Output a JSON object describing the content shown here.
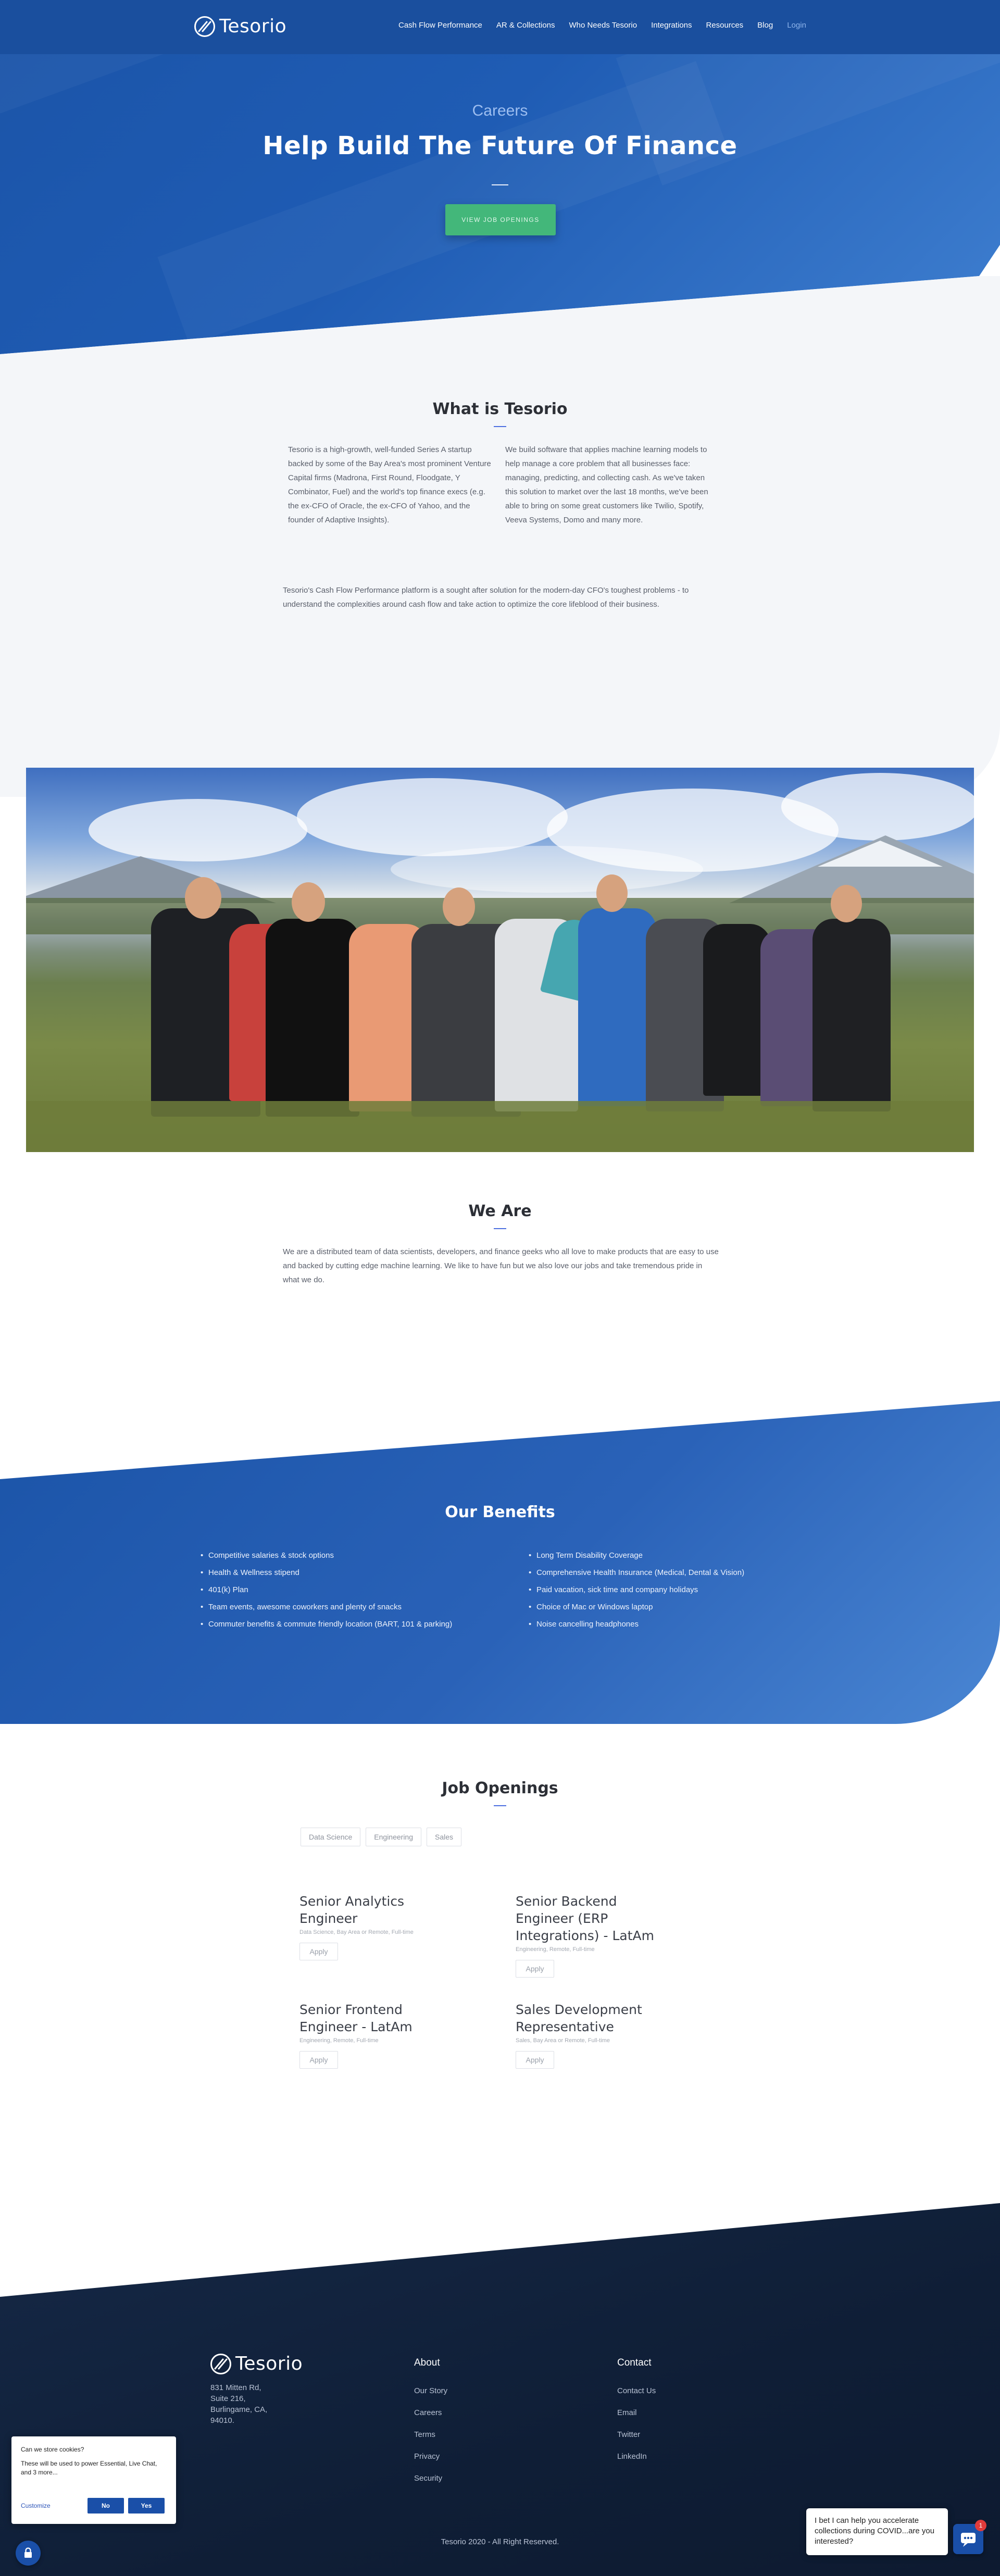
{
  "nav": {
    "brand": "Tesorio",
    "links": [
      "Cash Flow Performance",
      "AR & Collections",
      "Who Needs Tesorio",
      "Integrations",
      "Resources",
      "Blog",
      "Login"
    ]
  },
  "hero": {
    "kicker": "Careers",
    "title": "Help Build The Future Of Finance",
    "cta": "View Job Openings"
  },
  "what": {
    "title": "What is Tesorio",
    "col1": "Tesorio is a high-growth, well-funded Series A startup backed by some of the Bay Area's most prominent Venture Capital firms (Madrona, First Round, Floodgate, Y Combinator, Fuel) and the world's top finance execs (e.g. the ex-CFO of Oracle, the ex-CFO of Yahoo, and the founder of Adaptive Insights).",
    "col2": "We build software that applies machine learning models to help manage a core problem that all businesses face: managing, predicting, and collecting cash. As we've taken this solution to market over the last 18 months, we've been able to bring on some great customers like Twilio, Spotify, Veeva Systems, Domo and many more.",
    "para": "Tesorio's Cash Flow Performance  platform is a sought after solution for the modern-day CFO's toughest problems - to understand the complexities around cash flow and take action to optimize the core lifeblood of their business."
  },
  "we_are": {
    "title": "We Are",
    "text": "We are a distributed team of data scientists, developers, and finance geeks who all love to make products that are easy to use and backed by cutting edge machine learning. We like to have fun but we also love our jobs and take tremendous pride in what we do."
  },
  "benefits": {
    "title": "Our Benefits",
    "left": [
      "Competitive salaries & stock options",
      "Health & Wellness stipend",
      "401(k) Plan",
      "Team events, awesome coworkers and plenty of snacks",
      "Commuter benefits & commute friendly location (BART, 101 & parking)"
    ],
    "right": [
      "Long Term Disability Coverage",
      "Comprehensive Health Insurance (Medical, Dental & Vision)",
      "Paid vacation, sick time and company holidays",
      "Choice of Mac or Windows laptop",
      "Noise cancelling headphones"
    ]
  },
  "jobs": {
    "title": "Job Openings",
    "filters": [
      "Data Science",
      "Engineering",
      "Sales"
    ],
    "apply_label": "Apply",
    "items": [
      {
        "title": "Senior Analytics Engineer",
        "meta": "Data Science, Bay Area or Remote, Full-time"
      },
      {
        "title": "Senior Backend Engineer (ERP Integrations) - LatAm",
        "meta": "Engineering, Remote, Full-time"
      },
      {
        "title": "Senior Frontend Engineer - LatAm",
        "meta": "Engineering, Remote, Full-time"
      },
      {
        "title": "Sales Development Representative",
        "meta": "Sales, Bay Area or Remote, Full-time"
      }
    ]
  },
  "footer": {
    "brand": "Tesorio",
    "address": [
      "831 Mitten Rd,",
      "Suite 216,",
      "Burlingame, CA,",
      "94010."
    ],
    "about_title": "About",
    "about_links": [
      "Our Story",
      "Careers",
      "Terms",
      "Privacy",
      "Security"
    ],
    "contact_title": "Contact",
    "contact_links": [
      "Contact Us",
      "Email",
      "Twitter",
      "LinkedIn"
    ],
    "copyright": "Tesorio 2020 - All Right Reserved."
  },
  "cookie": {
    "title": "Can we store cookies?",
    "text": "These will be used to power Essential, Live Chat, and 3 more...",
    "customize": "Customize",
    "no": "No",
    "yes": "Yes"
  },
  "chat": {
    "message": "I bet I can help you accelerate collections during COVID...are you interested?",
    "badge": "1"
  },
  "colors": {
    "brand_blue": "#1f5cb4",
    "cta_green": "#43b77a",
    "footer_navy": "#0f1e36",
    "accent_rule": "#4c6fe0"
  }
}
